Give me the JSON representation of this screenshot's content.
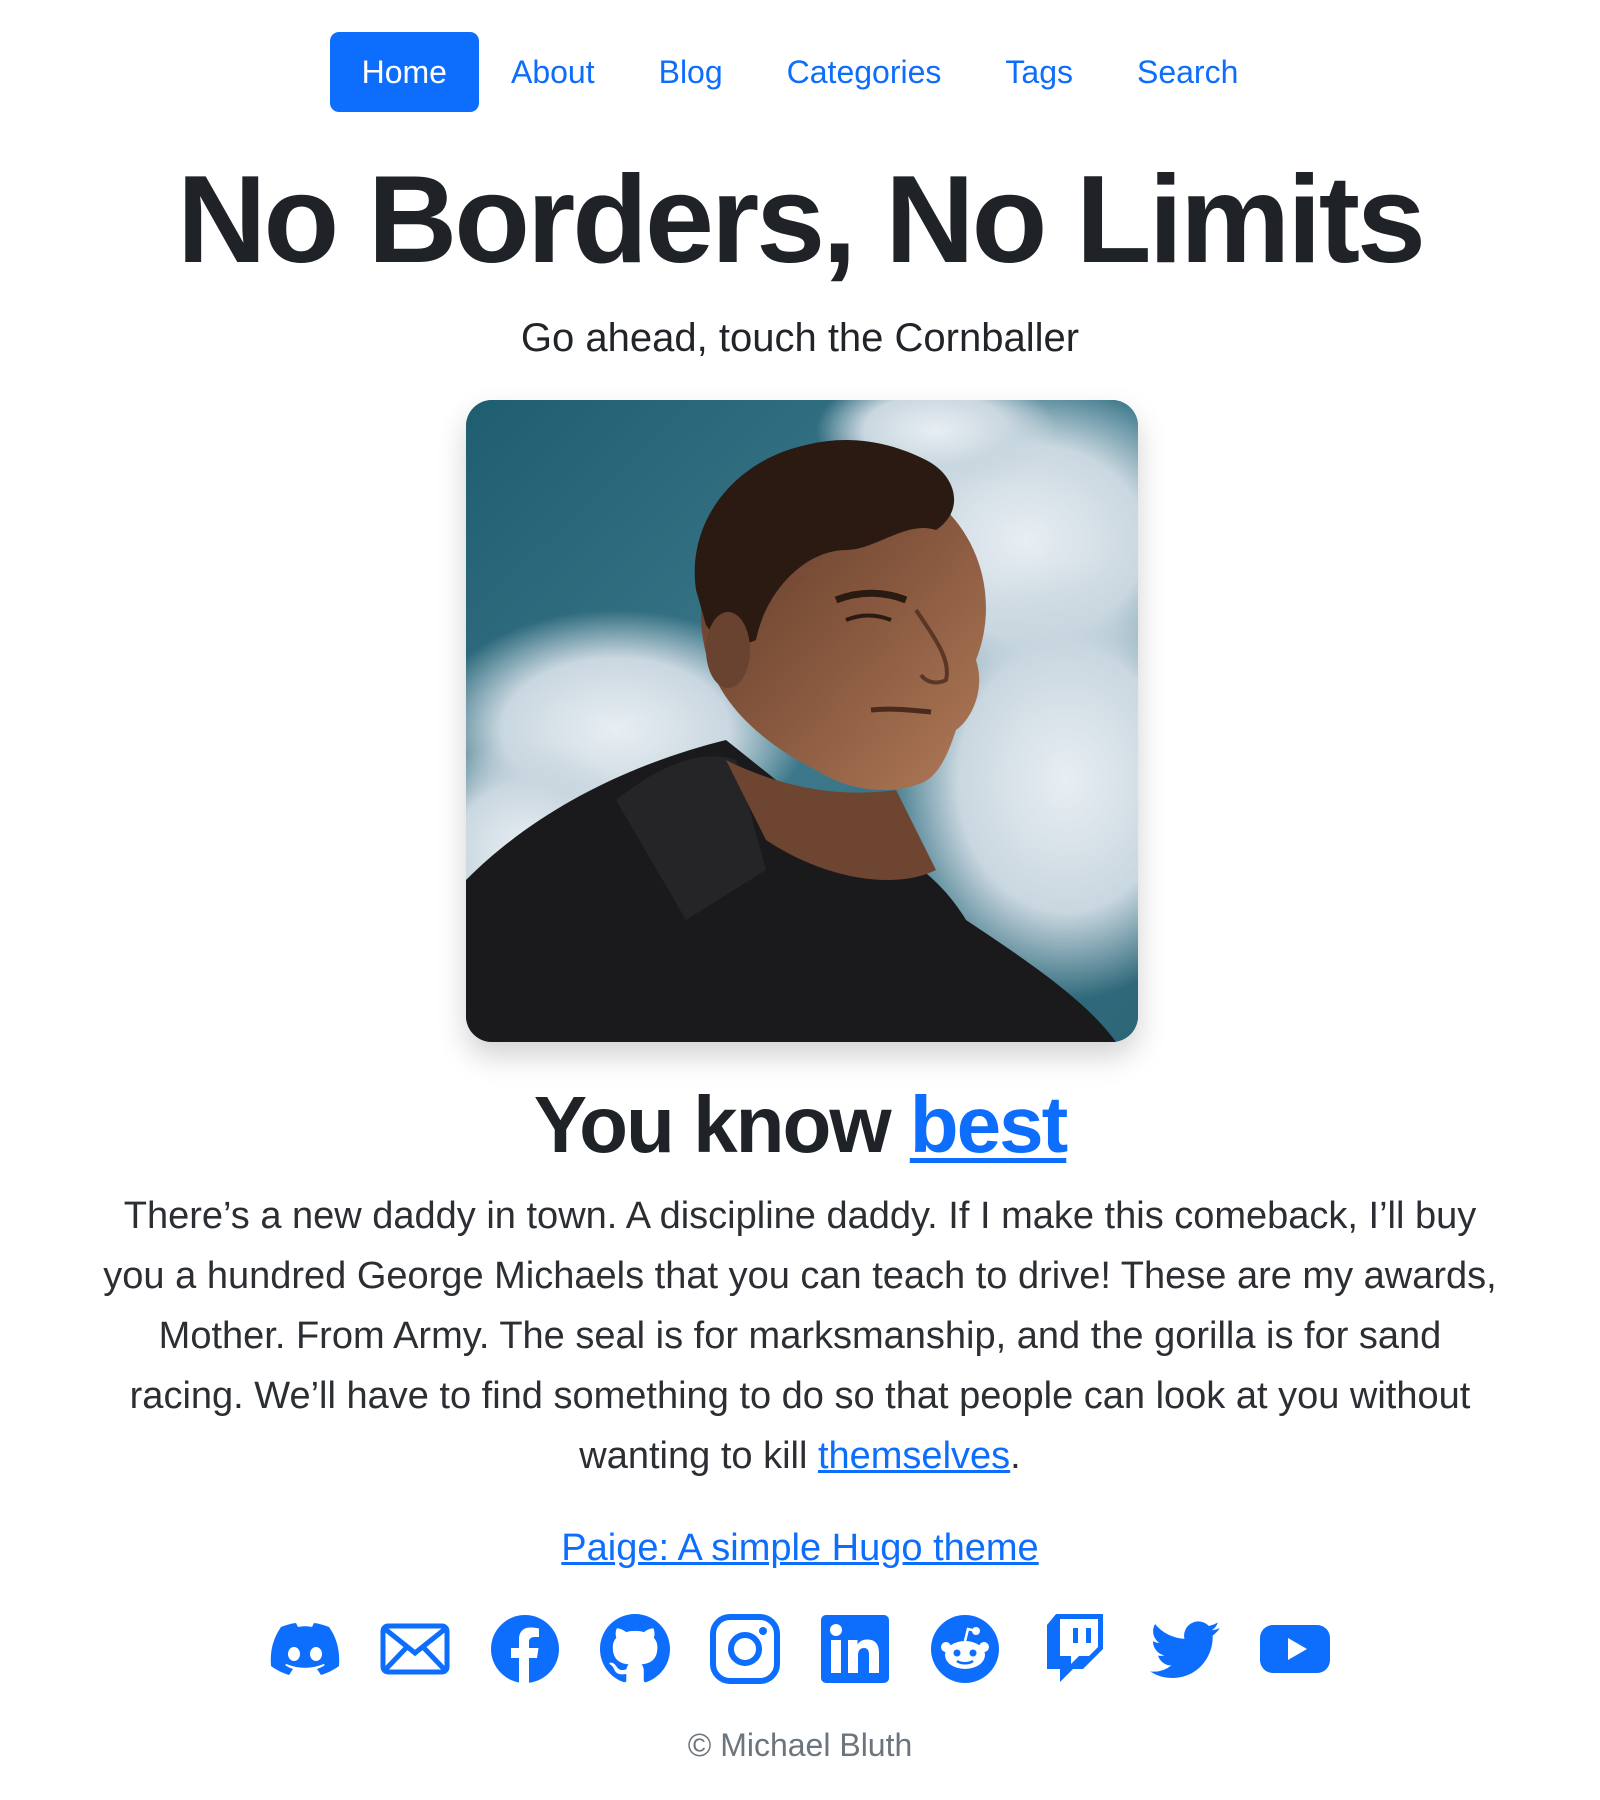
{
  "nav": {
    "items": [
      {
        "label": "Home",
        "active": true
      },
      {
        "label": "About"
      },
      {
        "label": "Blog"
      },
      {
        "label": "Categories"
      },
      {
        "label": "Tags"
      },
      {
        "label": "Search"
      }
    ]
  },
  "hero": {
    "title": "No Borders, No Limits",
    "subtitle": "Go ahead, touch the Cornballer"
  },
  "photo": {
    "subject": "man in dark hoodie against cloudy sky"
  },
  "section": {
    "heading_prefix": "You know ",
    "heading_link": "best",
    "paragraph_text": "There’s a new daddy in town. A discipline daddy. If I make this comeback, I’ll buy you a hundred George Michaels that you can teach to drive! These are my awards, Mother. From Army. The seal is for marksmanship, and the gorilla is for sand racing. We’ll have to find something to do so that people can look at you without wanting to kill ",
    "paragraph_link": "themselves",
    "paragraph_end": "."
  },
  "theme_link": "Paige: A simple Hugo theme",
  "social_icons": [
    "discord-icon",
    "email-icon",
    "facebook-icon",
    "github-icon",
    "instagram-icon",
    "linkedin-icon",
    "reddit-icon",
    "twitch-icon",
    "twitter-icon",
    "youtube-icon"
  ],
  "footer": {
    "copyright": "© Michael Bluth"
  },
  "colors": {
    "accent": "#0d6efd",
    "text": "#212529",
    "muted": "#6c757d",
    "background": "#ffffff"
  }
}
